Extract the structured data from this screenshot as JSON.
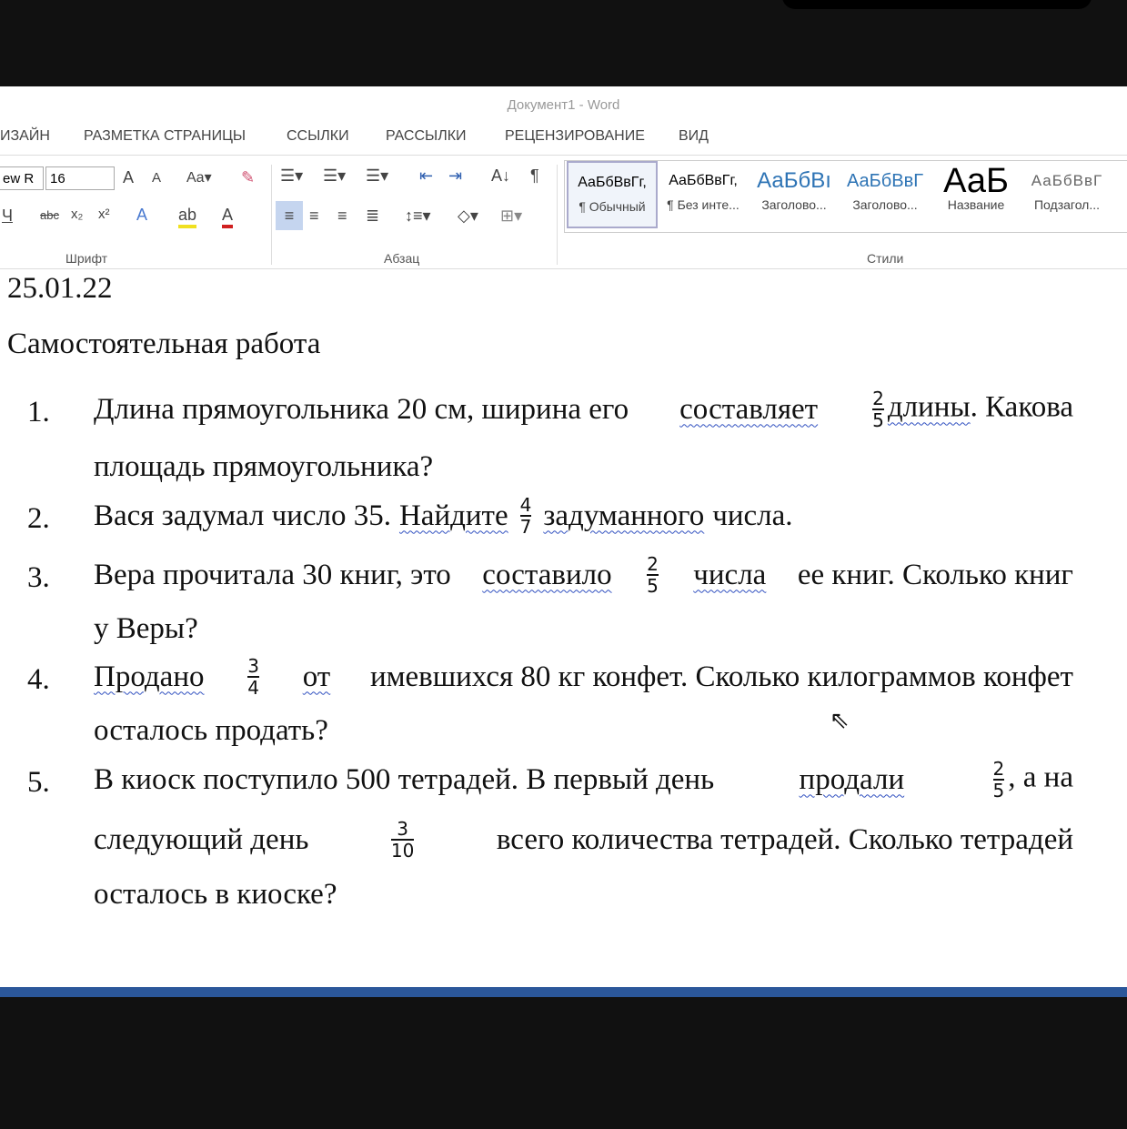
{
  "window": {
    "title": "Документ1 - Word"
  },
  "tabs": [
    "ИЗАЙН",
    "РАЗМЕТКА СТРАНИЦЫ",
    "ССЫЛКИ",
    "РАССЫЛКИ",
    "РЕЦЕНЗИРОВАНИЕ",
    "ВИД"
  ],
  "font": {
    "name": "ew R",
    "size": "16",
    "group": "Шрифт"
  },
  "paragraph": {
    "group": "Абзац"
  },
  "styles": {
    "group": "Стили",
    "items": [
      {
        "sample": "АаБбВвГг,",
        "name": "¶ Обычный"
      },
      {
        "sample": "АаБбВвГг,",
        "name": "¶ Без инте..."
      },
      {
        "sample": "АаБбВı",
        "name": "Заголово..."
      },
      {
        "sample": "АаБбВвГ",
        "name": "Заголово..."
      },
      {
        "sample": "АаБ",
        "name": "Название"
      },
      {
        "sample": "АаБбВвГ",
        "name": "Подзагол..."
      }
    ]
  },
  "doc": {
    "date": "25.01.22",
    "heading": "Самостоятельная работа",
    "p1": {
      "n": "1.",
      "a": "Длина прямоугольника 20 см, ширина его",
      "b": "составляет",
      "fn": "2",
      "fd": "5",
      "c": "длины",
      ". ": "",
      "d": ". Какова",
      "e": "площадь прямоугольника?"
    },
    "p2": {
      "n": "2.",
      "a": "Вася задумал число 35.",
      "b": "Найдите",
      "fn": "4",
      "fd": "7",
      "c": "задуманного",
      "d": "числа."
    },
    "p3": {
      "n": "3.",
      "a": "Вера прочитала 30 книг, это",
      "b": "составило",
      "fn": "2",
      "fd": "5",
      "c": "числа",
      "d": "ее книг. Сколько книг",
      "e": "у Веры?"
    },
    "p4": {
      "n": "4.",
      "b": "Продано",
      "fn": "3",
      "fd": "4",
      "c": "от",
      "d": "имевшихся 80 кг конфет. Сколько килограммов конфет",
      "e": "осталось продать?"
    },
    "p5": {
      "n": "5.",
      "a": "В киоск поступило 500 тетрадей. В первый день",
      "b": "продали",
      "fn": "2",
      "fd": "5",
      "d": ", а на",
      "e": "следующий день",
      "fn2": "3",
      "fd2": "10",
      "f": "всего количества тетрадей. Сколько тетрадей",
      "g": "осталось в киоске?"
    }
  }
}
